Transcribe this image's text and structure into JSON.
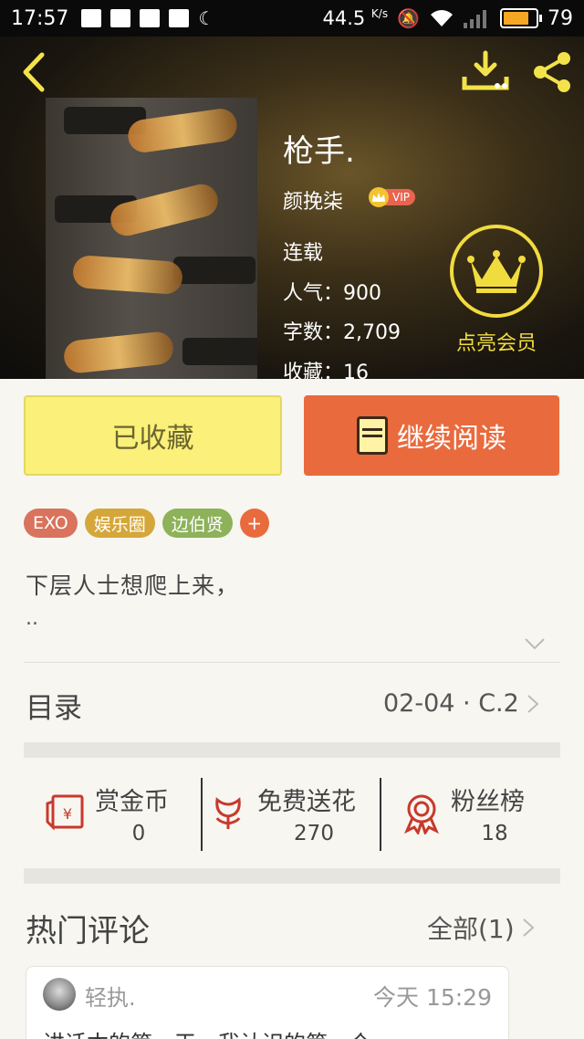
{
  "status_bar": {
    "time": "17:57",
    "net_speed": "44.5",
    "net_unit": "K/s",
    "battery": "79"
  },
  "book": {
    "title": "枪手.",
    "author": "颜挽柒",
    "vip_tag": "VIP",
    "status": "连载",
    "popularity": "人气：900",
    "word_count": "字数：2,709",
    "favorites": "收藏：16"
  },
  "member": {
    "label": "点亮会员"
  },
  "buttons": {
    "collected": "已收藏",
    "continue_reading": "继续阅读"
  },
  "tags": [
    {
      "label": "EXO",
      "color": "#d9735d"
    },
    {
      "label": "娱乐圈",
      "color": "#d5a73a"
    },
    {
      "label": "边伯贤",
      "color": "#8db25a"
    }
  ],
  "tag_add": "+",
  "description": {
    "line1": "下层人士想爬上来，",
    "line2": ".."
  },
  "catalog": {
    "title": "目录",
    "latest": "02-04 · C.2"
  },
  "stats": {
    "reward": {
      "label": "赏金币",
      "value": "0"
    },
    "flowers": {
      "label": "免费送花",
      "value": "270"
    },
    "fans": {
      "label": "粉丝榜",
      "value": "18"
    }
  },
  "comments": {
    "title": "热门评论",
    "all_label": "全部(1)",
    "items": [
      {
        "user": "轻执.",
        "time": "今天 15:29",
        "text": "讲话本的第一天，我认识的第一个"
      }
    ]
  },
  "colors": {
    "accent_orange": "#e96a3d",
    "accent_yellow": "#faf07a",
    "gold": "#f1dc3e"
  }
}
